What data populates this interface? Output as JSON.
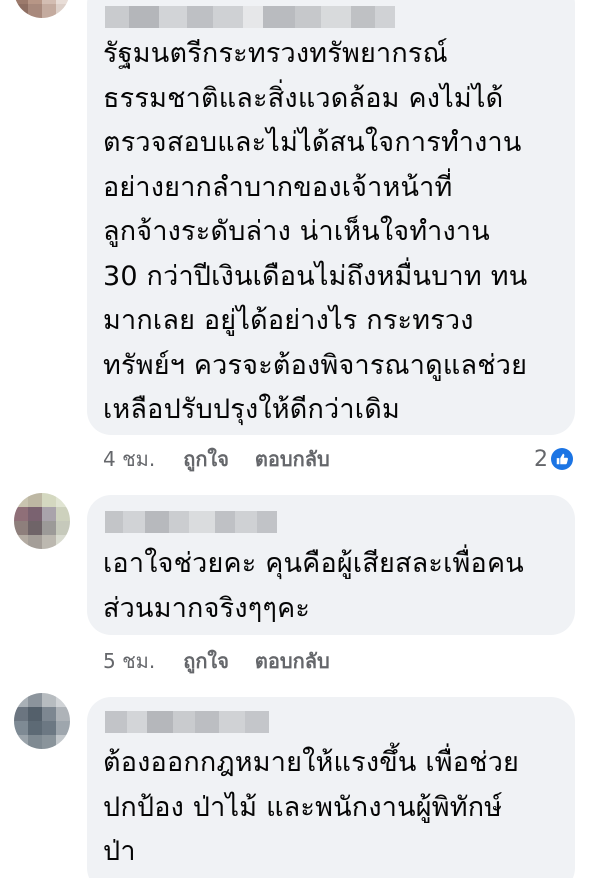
{
  "comments": [
    {
      "text": "รัฐมนตรีกระทรวงทรัพยากรณ์\nธรรมชาติและสิ่งแวดล้อม คงไม่ได้\nตรวจสอบและไม่ได้สนใจการทำงาน\nอย่างยากลำบากของเจ้าหน้าที่\nลูกจ้างระดับล่าง น่าเห็นใจทำงาน\n30 กว่าปีเงินเดือนไม่ถึงหมื่นบาท ทน\nมากเลย อยู่ได้อย่างไร กระทรวง\nทรัพย์ฯ ควรจะต้องพิจารณาดูแลช่วย\nเหลือปรับปรุงให้ดีกว่าเดิม",
      "time": "4 ชม.",
      "like_label": "ถูกใจ",
      "reply_label": "ตอบกลับ",
      "reaction_count": "2",
      "reaction_icon": "thumbs-up-icon"
    },
    {
      "text": "เอาใจช่วยคะ คุนคือผู้เสียสละเพื่อคน\nส่วนมากจริงๆๆคะ",
      "time": "5 ชม.",
      "like_label": "ถูกใจ",
      "reply_label": "ตอบกลับ"
    },
    {
      "text": "ต้องออกกฎหมายให้แรงขึ้น เพื่อช่วย\nปกป้อง ป่าไม้ และพนักงานผู้พิทักษ์\nป่า"
    }
  ],
  "colors": {
    "bubble": "#f0f2f5",
    "meta_text": "#65676b",
    "reaction_blue": "#1b74e4"
  }
}
